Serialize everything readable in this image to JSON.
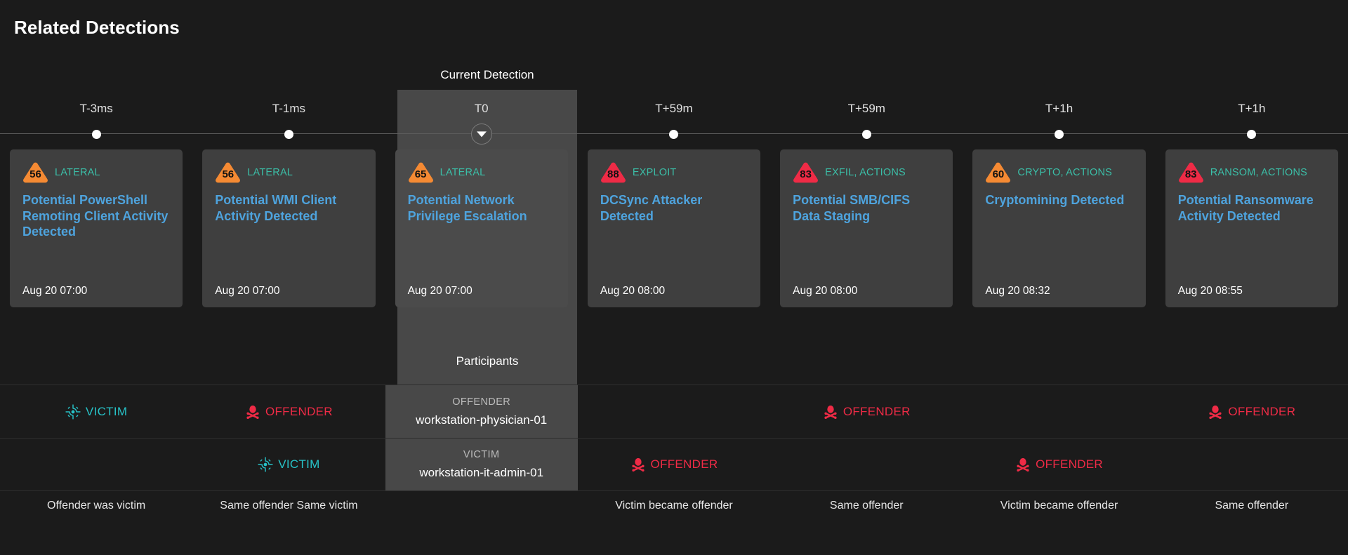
{
  "page": {
    "title": "Related Detections",
    "current_caption": "Current Detection",
    "participants_caption": "Participants"
  },
  "colors": {
    "background": "#1b1b1b",
    "card": "#3f3f3f",
    "highlight": "#484848",
    "title_link": "#4ea3dd",
    "category": "#3bbfa8",
    "victim": "#27c2c7",
    "offender": "#ef2b46",
    "score_high": "#ef2b46",
    "score_medium": "#f58a33"
  },
  "timeline": [
    {
      "label": "T-3ms",
      "current": false
    },
    {
      "label": "T-1ms",
      "current": false
    },
    {
      "label": "T0",
      "current": true
    },
    {
      "label": "T+59m",
      "current": false
    },
    {
      "label": "T+59m",
      "current": false
    },
    {
      "label": "T+1h",
      "current": false
    },
    {
      "label": "T+1h",
      "current": false
    }
  ],
  "detections": [
    {
      "score": "56",
      "severity": "medium",
      "categories": "LATERAL",
      "title": "Potential PowerShell Remoting Client Activity Detected",
      "timestamp": "Aug 20 07:00",
      "current": false
    },
    {
      "score": "56",
      "severity": "medium",
      "categories": "LATERAL",
      "title": "Potential WMI Client Activity Detected",
      "timestamp": "Aug 20 07:00",
      "current": false
    },
    {
      "score": "65",
      "severity": "medium",
      "categories": "LATERAL",
      "title": "Potential Network Privilege Escalation",
      "timestamp": "Aug 20 07:00",
      "current": true
    },
    {
      "score": "88",
      "severity": "high",
      "categories": "EXPLOIT",
      "title": "DCSync Attacker Detected",
      "timestamp": "Aug 20 08:00",
      "current": false
    },
    {
      "score": "83",
      "severity": "high",
      "categories": "EXFIL, ACTIONS",
      "title": "Potential SMB/CIFS Data Staging",
      "timestamp": "Aug 20 08:00",
      "current": false
    },
    {
      "score": "60",
      "severity": "medium",
      "categories": "CRYPTO, ACTIONS",
      "title": "Cryptomining Detected",
      "timestamp": "Aug 20 08:32",
      "current": false
    },
    {
      "score": "83",
      "severity": "high",
      "categories": "RANSOM, ACTIONS",
      "title": "Potential Ransomware Activity Detected",
      "timestamp": "Aug 20 08:55",
      "current": false
    }
  ],
  "participants_row_1": [
    {
      "role": "VICTIM",
      "icon": "victim-target-icon",
      "host": "",
      "current": false
    },
    {
      "role": "OFFENDER",
      "icon": "offender-skull-icon",
      "host": "",
      "current": false
    },
    {
      "role": "OFFENDER",
      "icon": "",
      "host": "workstation-physician-01",
      "current": true
    },
    {
      "role": "",
      "icon": "",
      "host": "",
      "current": false
    },
    {
      "role": "OFFENDER",
      "icon": "offender-skull-icon",
      "host": "",
      "current": false
    },
    {
      "role": "",
      "icon": "",
      "host": "",
      "current": false
    },
    {
      "role": "OFFENDER",
      "icon": "offender-skull-icon",
      "host": "",
      "current": false
    }
  ],
  "participants_row_2": [
    {
      "role": "",
      "icon": "",
      "host": "",
      "current": false
    },
    {
      "role": "VICTIM",
      "icon": "victim-target-icon",
      "host": "",
      "current": false
    },
    {
      "role": "VICTIM",
      "icon": "",
      "host": "workstation-it-admin-01",
      "current": true
    },
    {
      "role": "OFFENDER",
      "icon": "offender-skull-icon",
      "host": "",
      "current": false
    },
    {
      "role": "",
      "icon": "",
      "host": "",
      "current": false
    },
    {
      "role": "OFFENDER",
      "icon": "offender-skull-icon",
      "host": "",
      "current": false
    },
    {
      "role": "",
      "icon": "",
      "host": "",
      "current": false
    }
  ],
  "relations": [
    "Offender was victim",
    "Same offender Same victim",
    "",
    "Victim became offender",
    "Same offender",
    "Victim became offender",
    "Same offender"
  ]
}
